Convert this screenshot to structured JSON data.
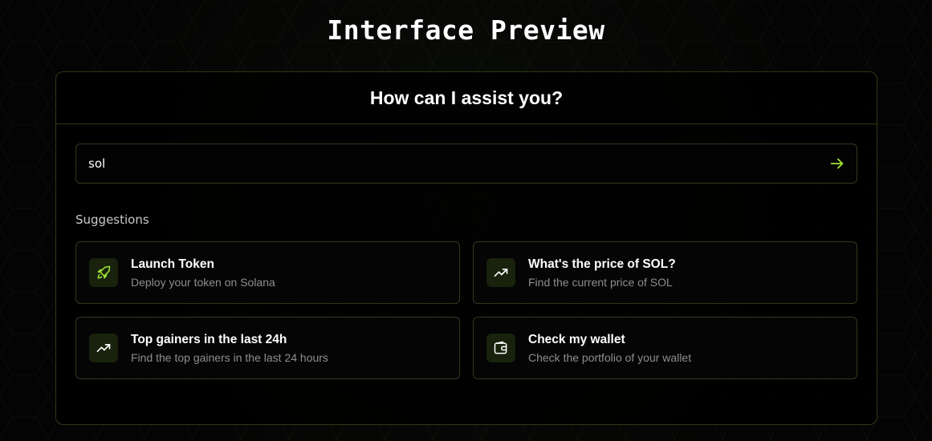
{
  "page": {
    "title": "Interface Preview"
  },
  "assistant": {
    "heading": "How can I assist you?",
    "search": {
      "value": "sol",
      "send_icon": "arrow-right-icon"
    },
    "suggestions_label": "Suggestions",
    "suggestions": [
      {
        "title": "Launch Token",
        "description": "Deploy your token on Solana",
        "icon": "rocket-icon"
      },
      {
        "title": "What's the price of SOL?",
        "description": "Find the current price of SOL",
        "icon": "trending-up-icon"
      },
      {
        "title": "Top gainers in the last 24h",
        "description": "Find the top gainers in the last 24 hours",
        "icon": "trending-up-icon"
      },
      {
        "title": "Check my wallet",
        "description": "Check the portfolio of your wallet",
        "icon": "wallet-icon"
      }
    ]
  },
  "colors": {
    "accent": "#a3e635",
    "background": "#050505",
    "border": "#2c3a16",
    "icon_bg": "#18220c",
    "muted_text": "#8e8e8e"
  }
}
